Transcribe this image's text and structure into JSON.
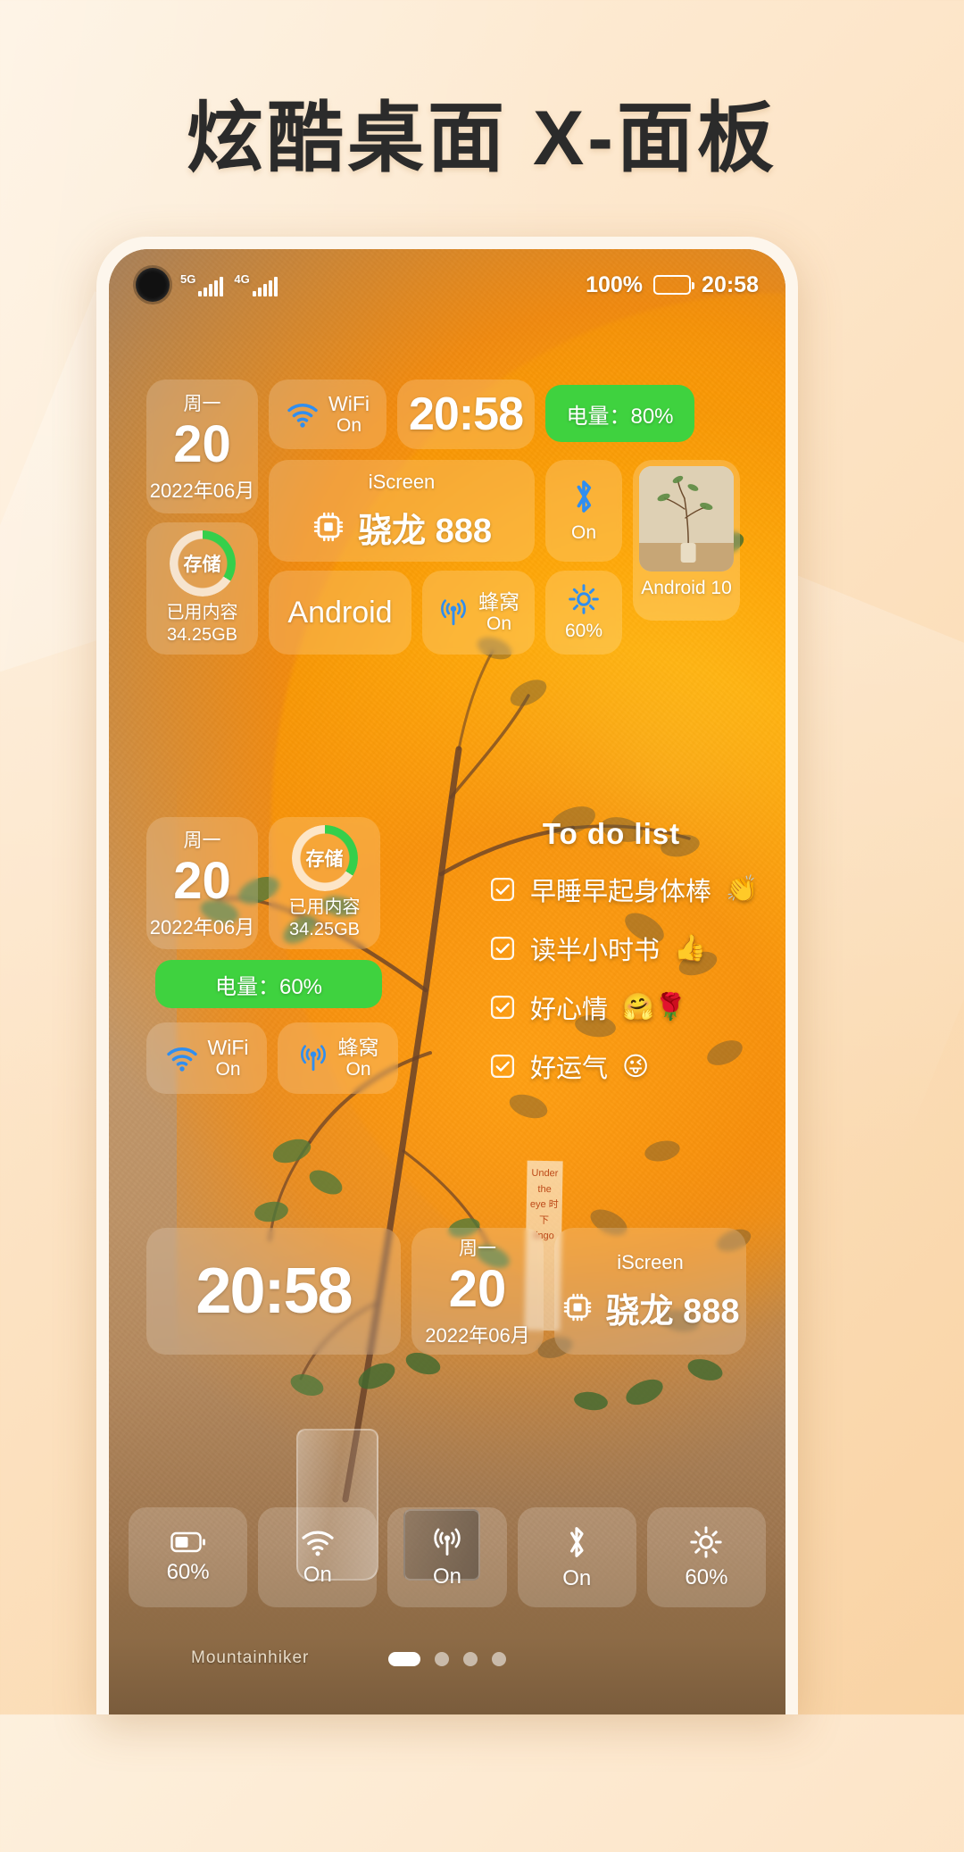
{
  "headline": "炫酷桌面 X-面板",
  "statusbar": {
    "net1": "5G",
    "net2": "4G",
    "battery_percent": "100%",
    "time": "20:58"
  },
  "widgets": {
    "date_top": {
      "dow": "周一",
      "day": "20",
      "ym": "2022年06月"
    },
    "wifi_top": {
      "title": "WiFi",
      "state": "On"
    },
    "clock_top": "20:58",
    "battery_top": "电量：80%",
    "storage_top": {
      "ring_label": "存储",
      "caption_line1": "已用内容",
      "caption_line2": "34.25GB"
    },
    "iscreen_top": {
      "brand": "iScreen",
      "cpu": "骁龙 888",
      "os": "Android"
    },
    "cellular_top": {
      "title": "蜂窝",
      "state": "On"
    },
    "bluetooth_top": {
      "state": "On"
    },
    "brightness_top": {
      "value": "60%"
    },
    "photo_top": {
      "caption": "Android 10"
    },
    "date_mid": {
      "dow": "周一",
      "day": "20",
      "ym": "2022年06月"
    },
    "storage_mid": {
      "ring_label": "存储",
      "caption_line1": "已用内容",
      "caption_line2": "34.25GB"
    },
    "battery_mid": "电量：60%",
    "wifi_mid": {
      "title": "WiFi",
      "state": "On"
    },
    "cellular_mid": {
      "title": "蜂窝",
      "state": "On"
    },
    "clock_bottom": "20:58",
    "date_bottom": {
      "dow": "周一",
      "day": "20",
      "ym": "2022年06月"
    },
    "iscreen_bottom": {
      "brand": "iScreen",
      "cpu": "骁龙 888"
    }
  },
  "todo": {
    "title": "To do list",
    "items": [
      {
        "text": "早睡早起身体棒",
        "emoji": "👏"
      },
      {
        "text": "读半小时书",
        "emoji": "👍"
      },
      {
        "text": "好心情",
        "emoji": "🤗🌹"
      },
      {
        "text": "好运气",
        "emoji": "😜"
      }
    ]
  },
  "dock": [
    {
      "icon": "battery-icon",
      "label": "60%"
    },
    {
      "icon": "wifi-icon",
      "label": "On"
    },
    {
      "icon": "cellular-icon",
      "label": "On"
    },
    {
      "icon": "bluetooth-icon",
      "label": "On"
    },
    {
      "icon": "brightness-icon",
      "label": "60%"
    }
  ],
  "shelf_label": "Mountainhiker",
  "colors": {
    "green": "#3fd23f",
    "blue": "#2f8ef0",
    "headline": "#2b2b2b"
  }
}
